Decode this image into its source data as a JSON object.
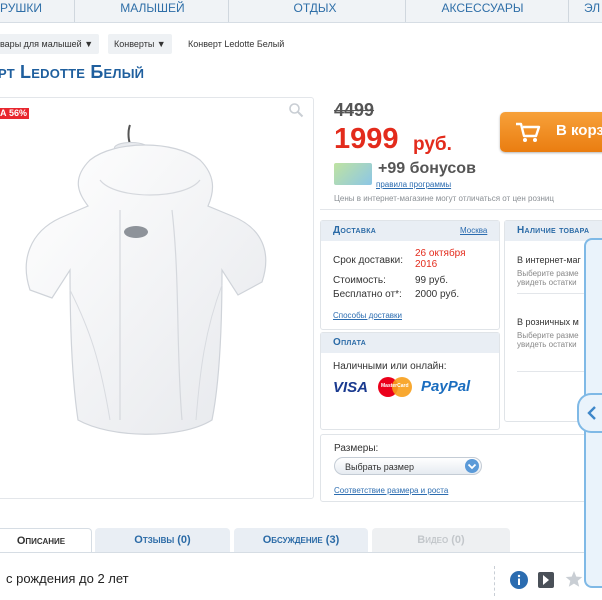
{
  "nav": {
    "items": [
      {
        "label": "рушки"
      },
      {
        "label": "малышей"
      },
      {
        "label": "отдых"
      },
      {
        "label": "аксессуары"
      },
      {
        "label": "эл"
      }
    ]
  },
  "breadcrumb": {
    "items": [
      "вары для малышей ▼",
      "Конверты ▼",
      "Конверт Ledotte Белый"
    ]
  },
  "product": {
    "title": "рт Ledotte Белый",
    "sale_badge": "А 56%",
    "price_old": "4499",
    "price_new": "1999",
    "currency": "руб.",
    "cart_label": "В корз",
    "bonus": "+99 бонусов",
    "bonus_link": "правила программы",
    "price_note": "Цены в интернет-магазине могут отличаться от цен розниц"
  },
  "delivery": {
    "title": "Доставка",
    "city": "Москва",
    "term_label": "Срок доставки:",
    "term_value_1": "26 октября",
    "term_value_2": "2016",
    "cost_label": "Стоимость:",
    "cost_value": "99 руб.",
    "free_label": "Бесплатно от*:",
    "free_value": "2000 руб.",
    "methods_link": "Способы доставки"
  },
  "payment": {
    "title": "Оплата",
    "text": "Наличными или онлайн:",
    "visa": "VISA",
    "mastercard": "MasterCard",
    "paypal": "PayPal"
  },
  "availability": {
    "title": "Наличие товара",
    "online_title": "В интернет-маг",
    "online_note_1": "Выберите разме",
    "online_note_2": "увидеть остатки",
    "retail_title": "В розничных м",
    "retail_note_1": "Выберите разме",
    "retail_note_2": "увидеть остатки"
  },
  "sizes": {
    "label": "Размеры:",
    "select_value": "Выбрать размер",
    "chart_link": "Соответствие размера и роста"
  },
  "tabs": [
    {
      "label": "Описание"
    },
    {
      "label": "Отзывы (0)"
    },
    {
      "label": "Обсуждение (3)"
    },
    {
      "label": "Видео (0)"
    }
  ],
  "description": "с рождения до 2 лет",
  "colors": {
    "accent": "#1f5f9e",
    "price": "#e32b1c",
    "cart": "#f08c1f"
  }
}
